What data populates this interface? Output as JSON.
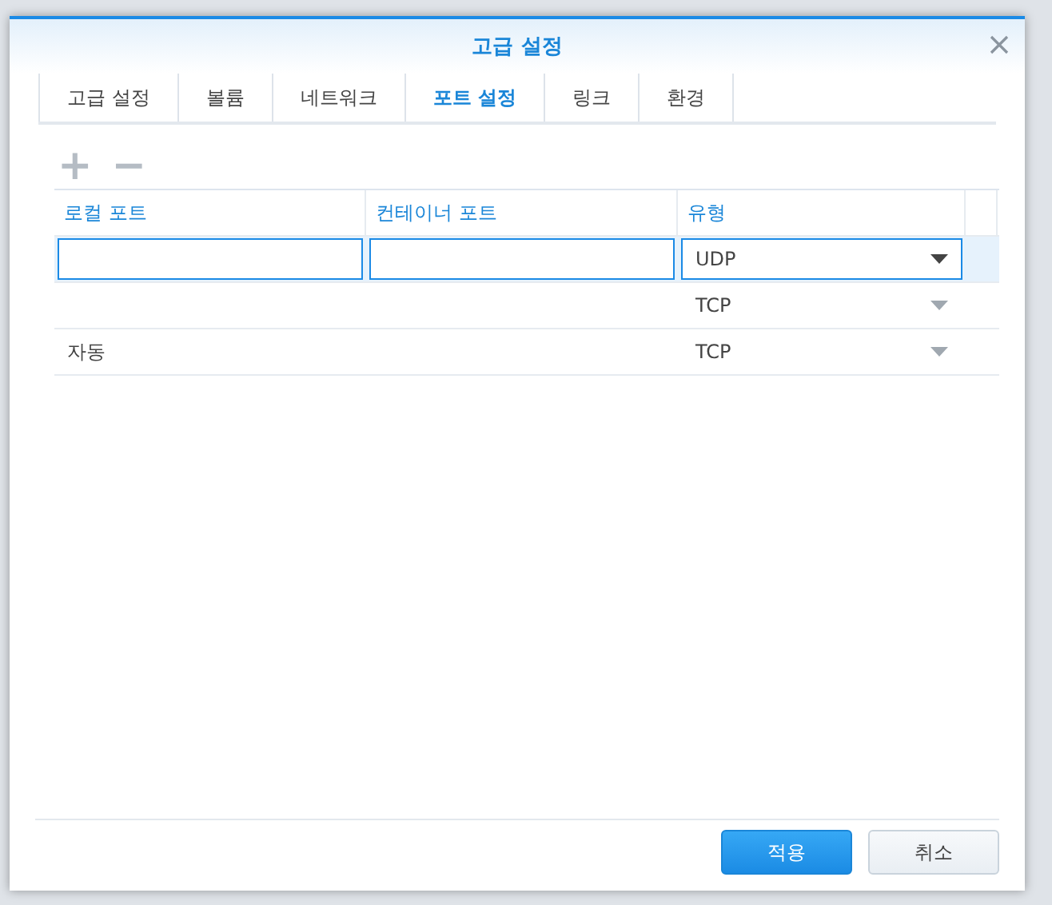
{
  "window": {
    "title": "고급 설정"
  },
  "tabs": [
    {
      "label": "고급 설정",
      "selected": false
    },
    {
      "label": "볼륨",
      "selected": false
    },
    {
      "label": "네트워크",
      "selected": false
    },
    {
      "label": "포트 설정",
      "selected": true
    },
    {
      "label": "링크",
      "selected": false
    },
    {
      "label": "환경",
      "selected": false
    }
  ],
  "toolbar": {
    "add": "+",
    "remove": "−"
  },
  "table": {
    "columns": [
      "로컬 포트",
      "컨테이너 포트",
      "유형"
    ],
    "rows": [
      {
        "selected": true,
        "editing": true,
        "local_port": "",
        "container_port": "",
        "type": "UDP"
      },
      {
        "selected": false,
        "editing": false,
        "local_port": "",
        "container_port": "",
        "type": "TCP"
      },
      {
        "selected": false,
        "editing": false,
        "local_port": "자동",
        "container_port": "",
        "type": "TCP"
      }
    ]
  },
  "buttons": [
    {
      "label": "적용",
      "kind": "primary"
    },
    {
      "label": "취소",
      "kind": "secondary"
    }
  ]
}
